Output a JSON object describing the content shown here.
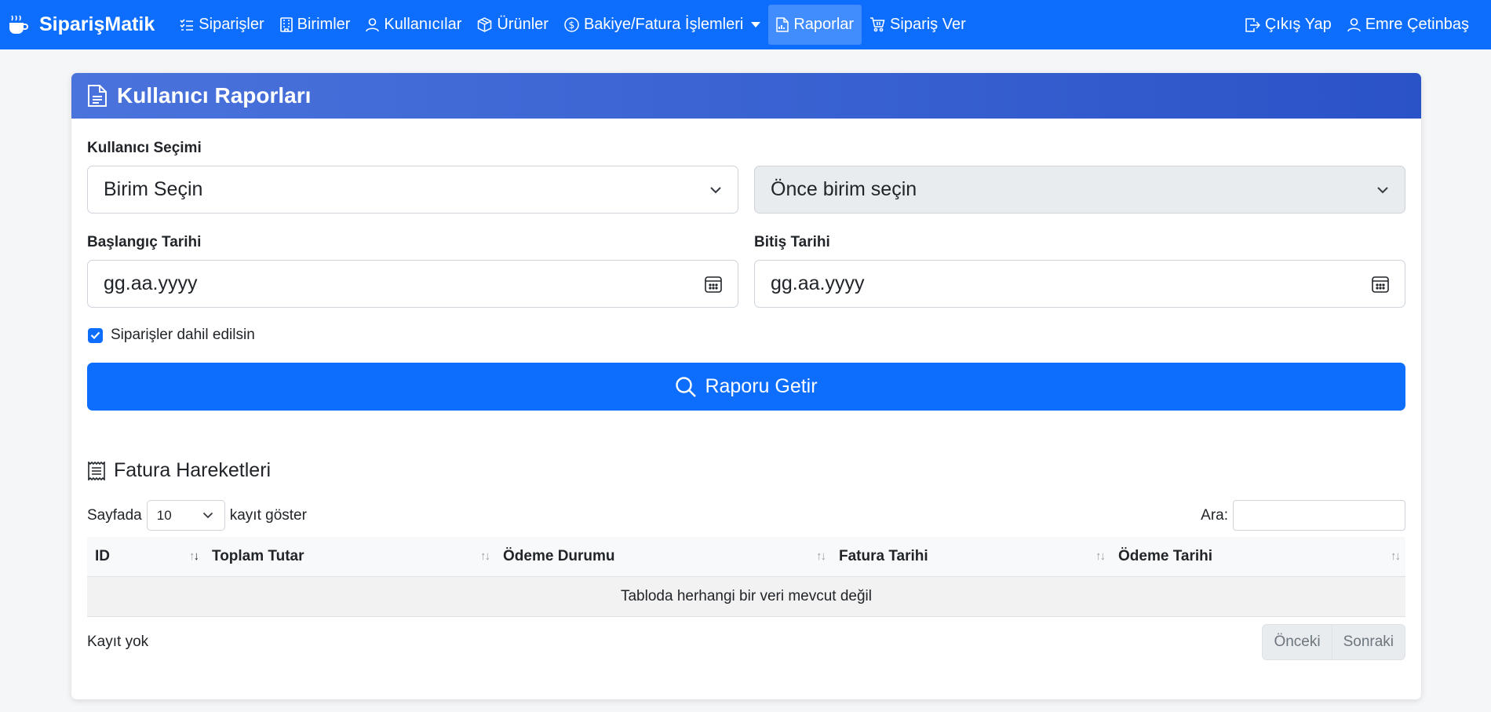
{
  "brand": {
    "name": "SiparişMatik",
    "icon": "coffee-cup-icon"
  },
  "nav": {
    "items": [
      {
        "label": "Siparişler",
        "icon": "list-check-icon"
      },
      {
        "label": "Birimler",
        "icon": "building-icon"
      },
      {
        "label": "Kullanıcılar",
        "icon": "person-icon"
      },
      {
        "label": "Ürünler",
        "icon": "box-icon"
      },
      {
        "label": "Bakiye/Fatura İşlemleri",
        "icon": "coin-icon"
      },
      {
        "label": "Raporlar",
        "icon": "report-icon"
      },
      {
        "label": "Sipariş Ver",
        "icon": "cart-icon"
      }
    ],
    "logout": "Çıkış Yap",
    "user": "Emre Çetinbaş"
  },
  "card": {
    "title": "Kullanıcı Raporları",
    "user_select_label": "Kullanıcı Seçimi",
    "unit_select_value": "Birim Seçin",
    "user_select_value": "Önce birim seçin",
    "start_date_label": "Başlangıç Tarihi",
    "end_date_label": "Bitiş Tarihi",
    "start_date_placeholder": "gg.aa.yyyy",
    "end_date_placeholder": "gg.aa.yyyy",
    "include_orders_label": "Siparişler dahil edilsin",
    "include_orders_checked": true,
    "submit_label": "Raporu Getir"
  },
  "invoices": {
    "title": "Fatura Hareketleri",
    "length_prefix": "Sayfada",
    "length_value": "10",
    "length_suffix": "kayıt göster",
    "search_label": "Ara:",
    "columns": [
      "ID",
      "Toplam Tutar",
      "Ödeme Durumu",
      "Fatura Tarihi",
      "Ödeme Tarihi"
    ],
    "empty_message": "Tabloda herhangi bir veri mevcut değil",
    "info": "Kayıt yok",
    "prev": "Önceki",
    "next": "Sonraki"
  },
  "colors": {
    "primary": "#0d6efd",
    "header_gradient_start": "#4a73dc",
    "header_gradient_end": "#2b53c8"
  }
}
